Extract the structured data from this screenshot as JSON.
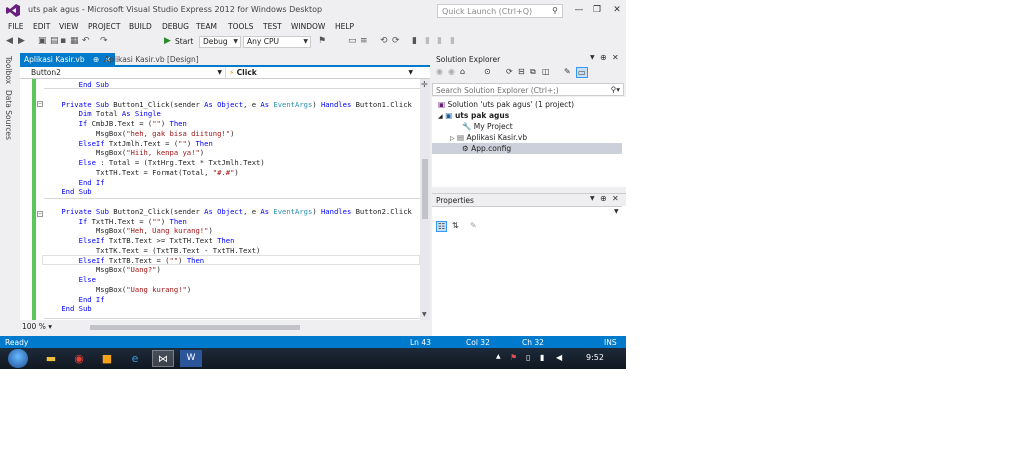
{
  "window": {
    "title": "uts pak agus - Microsoft Visual Studio Express 2012 for Windows Desktop",
    "quick_launch_placeholder": "Quick Launch (Ctrl+Q)"
  },
  "menu": [
    "FILE",
    "EDIT",
    "VIEW",
    "PROJECT",
    "BUILD",
    "DEBUG",
    "TEAM",
    "TOOLS",
    "TEST",
    "WINDOW",
    "HELP"
  ],
  "toolbar": {
    "start_label": "Start",
    "config": "Debug",
    "platform": "Any CPU"
  },
  "left_tabs": [
    "Toolbox",
    "Data Sources"
  ],
  "doc_tabs": [
    {
      "label": "Aplikasi Kasir.vb",
      "active": true
    },
    {
      "label": "Aplikasi Kasir.vb [Design]",
      "active": false
    }
  ],
  "nav": {
    "object": "Button2",
    "member": "Click"
  },
  "code_lines": [
    [
      {
        "t": "        "
      },
      {
        "t": "End Sub",
        "c": "kw"
      }
    ],
    [
      {
        "t": ""
      }
    ],
    [
      {
        "t": "    "
      },
      {
        "t": "Private Sub",
        "c": "kw"
      },
      {
        "t": " Button1_Click(sender "
      },
      {
        "t": "As Object",
        "c": "kw"
      },
      {
        "t": ", e "
      },
      {
        "t": "As",
        "c": "kw"
      },
      {
        "t": " "
      },
      {
        "t": "EventArgs",
        "c": "typ"
      },
      {
        "t": ") "
      },
      {
        "t": "Handles",
        "c": "kw"
      },
      {
        "t": " Button1.Click"
      }
    ],
    [
      {
        "t": "        "
      },
      {
        "t": "Dim",
        "c": "kw"
      },
      {
        "t": " Total "
      },
      {
        "t": "As Single",
        "c": "kw"
      }
    ],
    [
      {
        "t": "        "
      },
      {
        "t": "If",
        "c": "kw"
      },
      {
        "t": " CmbJB.Text = ("
      },
      {
        "t": "\"\"",
        "c": "str"
      },
      {
        "t": ") "
      },
      {
        "t": "Then",
        "c": "kw"
      }
    ],
    [
      {
        "t": "            MsgBox("
      },
      {
        "t": "\"heh, gak bisa diitung!\"",
        "c": "str"
      },
      {
        "t": ")"
      }
    ],
    [
      {
        "t": "        "
      },
      {
        "t": "ElseIf",
        "c": "kw"
      },
      {
        "t": " TxtJmlh.Text = ("
      },
      {
        "t": "\"\"",
        "c": "str"
      },
      {
        "t": ") "
      },
      {
        "t": "Then",
        "c": "kw"
      }
    ],
    [
      {
        "t": "            MsgBox("
      },
      {
        "t": "\"Hiih, kenpa ya!\"",
        "c": "str"
      },
      {
        "t": ")"
      }
    ],
    [
      {
        "t": "        "
      },
      {
        "t": "Else",
        "c": "kw"
      },
      {
        "t": " : Total = (TxtHrg.Text * TxtJmlh.Text)"
      }
    ],
    [
      {
        "t": "            TxtTH.Text = Format(Total, "
      },
      {
        "t": "\"#.#\"",
        "c": "str"
      },
      {
        "t": ")"
      }
    ],
    [
      {
        "t": "        "
      },
      {
        "t": "End If",
        "c": "kw"
      }
    ],
    [
      {
        "t": "    "
      },
      {
        "t": "End Sub",
        "c": "kw"
      }
    ],
    [
      {
        "t": ""
      }
    ],
    [
      {
        "t": "    "
      },
      {
        "t": "Private Sub",
        "c": "kw"
      },
      {
        "t": " Button2_Click(sender "
      },
      {
        "t": "As Object",
        "c": "kw"
      },
      {
        "t": ", e "
      },
      {
        "t": "As",
        "c": "kw"
      },
      {
        "t": " "
      },
      {
        "t": "EventArgs",
        "c": "typ"
      },
      {
        "t": ") "
      },
      {
        "t": "Handles",
        "c": "kw"
      },
      {
        "t": " Button2.Click"
      }
    ],
    [
      {
        "t": "        "
      },
      {
        "t": "If",
        "c": "kw"
      },
      {
        "t": " TxtTH.Text = ("
      },
      {
        "t": "\"\"",
        "c": "str"
      },
      {
        "t": ") "
      },
      {
        "t": "Then",
        "c": "kw"
      }
    ],
    [
      {
        "t": "            MsgBox("
      },
      {
        "t": "\"Heh, Uang kurang!\"",
        "c": "str"
      },
      {
        "t": ")"
      }
    ],
    [
      {
        "t": "        "
      },
      {
        "t": "ElseIf",
        "c": "kw"
      },
      {
        "t": " TxtTB.Text >= TxtTH.Text "
      },
      {
        "t": "Then",
        "c": "kw"
      }
    ],
    [
      {
        "t": "            TxtTK.Text = (TxtTB.Text - TxtTH.Text)"
      }
    ],
    [
      {
        "t": "        "
      },
      {
        "t": "ElseIf",
        "c": "kw"
      },
      {
        "t": " TxtTB.Text = ("
      },
      {
        "t": "\"\"",
        "c": "str"
      },
      {
        "t": ") "
      },
      {
        "t": "Then",
        "c": "kw"
      }
    ],
    [
      {
        "t": "            MsgBox("
      },
      {
        "t": "\"Uang?\"",
        "c": "str"
      },
      {
        "t": ")"
      }
    ],
    [
      {
        "t": "        "
      },
      {
        "t": "Else",
        "c": "kw"
      }
    ],
    [
      {
        "t": "            MsgBox("
      },
      {
        "t": "\"Uang kurang!\"",
        "c": "str"
      },
      {
        "t": ")"
      }
    ],
    [
      {
        "t": "        "
      },
      {
        "t": "End If",
        "c": "kw"
      }
    ],
    [
      {
        "t": "    "
      },
      {
        "t": "End Sub",
        "c": "kw"
      }
    ]
  ],
  "zoom": "100 %",
  "solution_explorer": {
    "title": "Solution Explorer",
    "search_placeholder": "Search Solution Explorer (Ctrl+;)",
    "nodes": [
      "Solution 'uts pak agus' (1 project)",
      "uts pak agus",
      "My Project",
      "Aplikasi Kasir.vb",
      "App.config"
    ]
  },
  "properties": {
    "title": "Properties"
  },
  "status": {
    "ready": "Ready",
    "line": "Ln 43",
    "col": "Col 32",
    "ch": "Ch 32",
    "mode": "INS"
  },
  "clock": "9:52",
  "colors": {
    "accent": "#007acc",
    "keyword": "#0000ff",
    "string": "#a31515",
    "type": "#2b91af"
  }
}
